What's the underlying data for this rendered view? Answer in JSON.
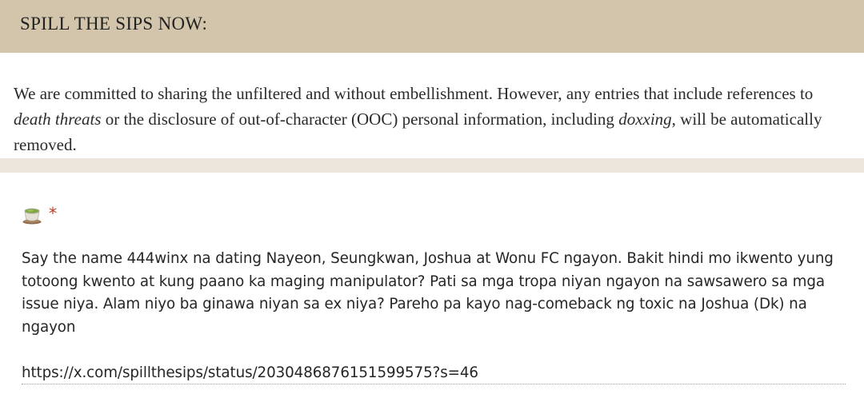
{
  "header": {
    "title": "SPILL THE SIPS NOW:"
  },
  "notice": {
    "part1": "We are committed to sharing the unfiltered and without embellishment. However, any entries that include references to ",
    "em1": "death threats",
    "part2": " or the disclosure of out-of-character (OOC) personal information, including ",
    "em2": "doxxing",
    "part3": ", will be automatically removed."
  },
  "question": {
    "icon": "tea-cup-icon",
    "required_mark": "*",
    "answer_text": "Say the name 444winx na dating Nayeon, Seungkwan, Joshua at Wonu FC ngayon. Bakit hindi mo ikwento yung totoong kwento at kung paano ka maging manipulator? Pati sa mga tropa niyan ngayon na sawsawero sa mga issue niya. Alam niyo ba ginawa niyan sa ex niya? Pareho pa kayo nag-comeback ng toxic na Joshua (Dk) na ngayon",
    "answer_link": "https://x.com/spillthesips/status/2030486876151599575?s=46"
  },
  "colors": {
    "header_bg": "#d2c5ab",
    "band_bg": "#ece6dc",
    "required": "#c0392b"
  }
}
